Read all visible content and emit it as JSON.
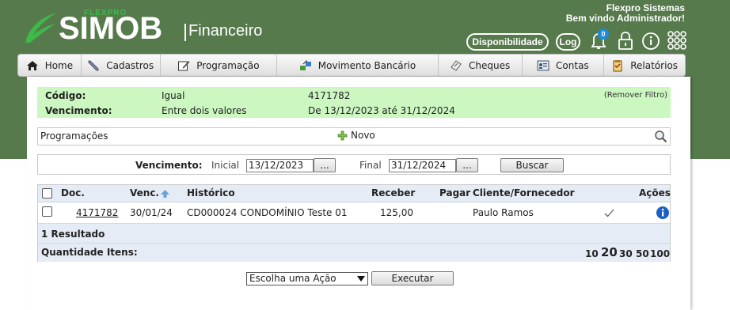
{
  "brand": {
    "small": "FLEXPRO",
    "main": "SIMOB",
    "sub": "Financeiro"
  },
  "welcome": {
    "company": "Flexpro Sistemas",
    "greeting": "Bem vindo Administrador!"
  },
  "header_buttons": {
    "disponibilidade": "Disponibilidade",
    "log": "Log",
    "notifications_count": "0"
  },
  "icons": {
    "bell": "bell-icon",
    "lock": "lock-icon",
    "info": "info-icon",
    "apps": "grid-icon"
  },
  "menu": [
    {
      "label": "Home",
      "icon": "home-icon"
    },
    {
      "label": "Cadastros",
      "icon": "pencil-icon"
    },
    {
      "label": "Programação",
      "icon": "edit-icon"
    },
    {
      "label": "Movimento Bancário",
      "icon": "bank-transfer-icon"
    },
    {
      "label": "Cheques",
      "icon": "cheque-icon"
    },
    {
      "label": "Contas",
      "icon": "accounts-icon"
    },
    {
      "label": "Relatórios",
      "icon": "report-icon"
    }
  ],
  "filters": {
    "codigo": {
      "label": "Código:",
      "op": "Igual",
      "value": "4171782"
    },
    "vencimento": {
      "label": "Vencimento:",
      "op": "Entre dois valores",
      "value": "De 13/12/2023 até 31/12/2024"
    },
    "remove": "(Remover Filtro)"
  },
  "programacoes": {
    "title": "Programações",
    "new_label": "Novo"
  },
  "search": {
    "label": "Vencimento:",
    "inicial_label": "Inicial",
    "inicial_value": "13/12/2023",
    "final_label": "Final",
    "final_value": "31/12/2024",
    "picker_label": "...",
    "buscar": "Buscar"
  },
  "table": {
    "headers": {
      "doc": "Doc.",
      "venc": "Venc.",
      "historico": "Histórico",
      "receber": "Receber",
      "pagar": "Pagar",
      "cliente": "Cliente/Fornecedor",
      "acoes": "Ações"
    },
    "rows": [
      {
        "doc": "4171782",
        "venc": "30/01/24",
        "historico": "CD000024 CONDOMÍNIO Teste 01",
        "receber": "125,00",
        "pagar": "",
        "cliente": "Paulo Ramos"
      }
    ],
    "result_count": "1 Resultado",
    "qty_label": "Quantidade Itens:",
    "page_sizes": [
      "10",
      "20",
      "30",
      "50",
      "100"
    ],
    "selected_page_size": "20"
  },
  "actions": {
    "select_value": "Escolha uma Ação",
    "execute": "Executar"
  }
}
